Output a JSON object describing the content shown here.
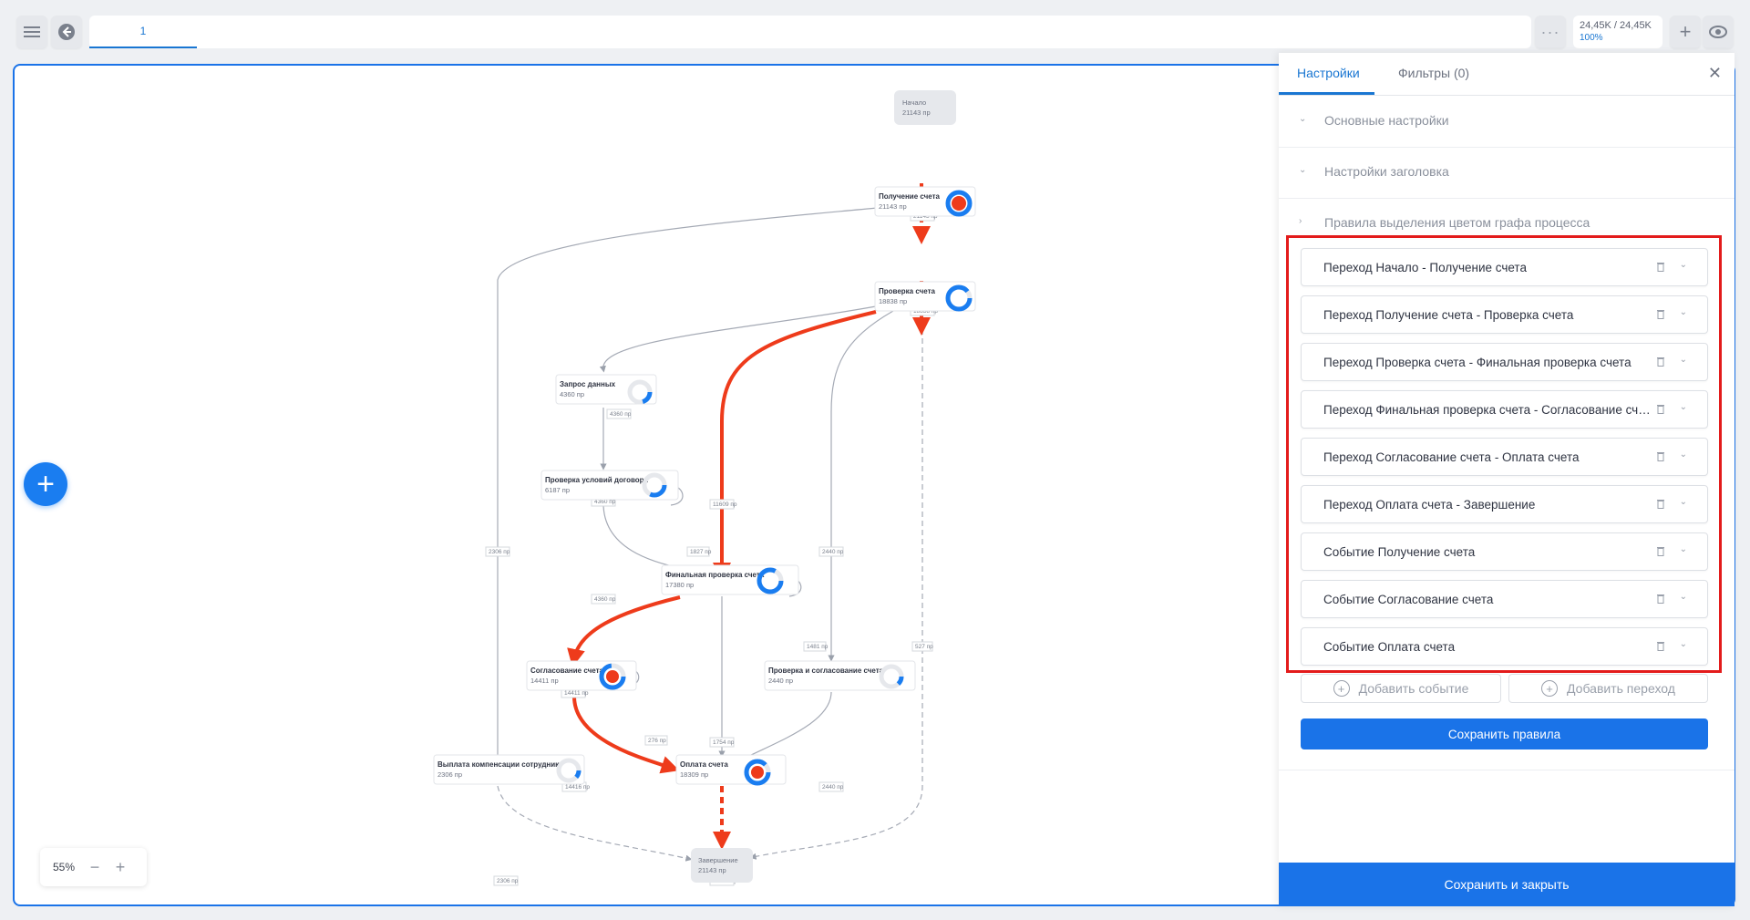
{
  "toolbar": {
    "tab_label": "1",
    "more_icon": "more-dots-icon",
    "events_count": "24,45K / 24,45K",
    "events_pct": "100%"
  },
  "graph": {
    "nodes": [
      {
        "id": "start",
        "title": "Начало",
        "count": "21143 пр"
      },
      {
        "id": "receive",
        "title": "Получение счета",
        "count": "21143 пр"
      },
      {
        "id": "check",
        "title": "Проверка счета",
        "count": "18838 пр"
      },
      {
        "id": "request",
        "title": "Запрос данных",
        "count": "4360 пр"
      },
      {
        "id": "contract",
        "title": "Проверка условий договора",
        "count": "6187 пр"
      },
      {
        "id": "final",
        "title": "Финальная проверка счета",
        "count": "17380 пр"
      },
      {
        "id": "approve",
        "title": "Согласование счета",
        "count": "14411 пр"
      },
      {
        "id": "checkapprove",
        "title": "Проверка и согласование счета",
        "count": "2440 пр"
      },
      {
        "id": "comp",
        "title": "Выплата компенсации сотруднику",
        "count": "2306 пр"
      },
      {
        "id": "pay",
        "title": "Оплата счета",
        "count": "18309 пр"
      },
      {
        "id": "end",
        "title": "Завершение",
        "count": "21143 пр"
      }
    ],
    "edge_labels": {
      "start_receive": "21143 пр",
      "receive_check": "18838 пр",
      "check_request": "4360 пр",
      "request_contract": "4360 пр",
      "contract_self": "1827 пр",
      "contract_final": "4360 пр",
      "check_final": "11609 пр",
      "check_checkapprove": "2440 пр",
      "receive_comp": "2306 пр",
      "check_end": "527 пр",
      "final_self": "1481 пр",
      "final_approve": "14411 пр",
      "final_pay": "1754 пр",
      "approve_self": "276 пр",
      "approve_pay": "14416 пр",
      "checkapprove_pay": "2440 пр",
      "comp_end": "2306 пр",
      "pay_end": "18305 пр"
    }
  },
  "zoom": {
    "value": "55%"
  },
  "panel": {
    "tabs": {
      "settings": "Настройки",
      "filters": "Фильтры (0)"
    },
    "sections": {
      "basic": "Основные настройки",
      "header": "Настройки заголовка",
      "color_rules": "Правила выделения цветом графа процесса"
    },
    "rules": [
      "Переход Начало - Получение счета",
      "Переход Получение счета - Проверка счета",
      "Переход Проверка счета - Финальная проверка счета",
      "Переход Финальная проверка счета - Согласование счета",
      "Переход Согласование счета - Оплата счета",
      "Переход Оплата счета - Завершение",
      "Событие Получение счета",
      "Событие Согласование счета",
      "Событие Оплата счета"
    ],
    "add_event": "Добавить событие",
    "add_transition": "Добавить переход",
    "save_rules": "Сохранить правила",
    "save_close": "Сохранить и закрыть"
  }
}
